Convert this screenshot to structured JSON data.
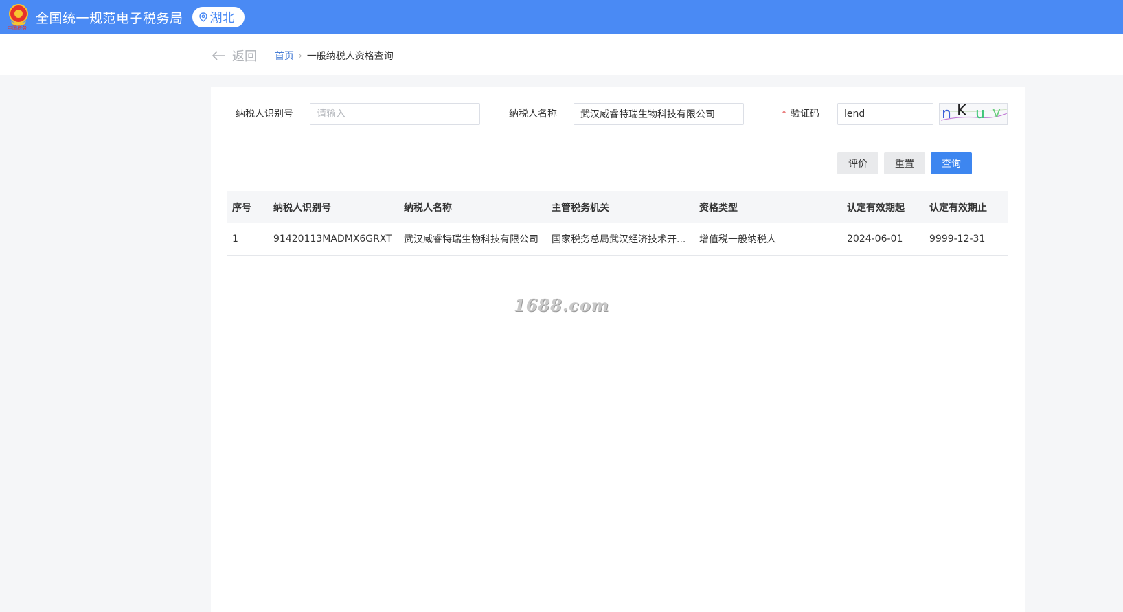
{
  "header": {
    "emblem": "tax-emblem-icon",
    "emblem_caption": "中国税务",
    "title": "全国统一规范电子税务局",
    "region": "湖北",
    "region_icon": "location-pin-icon"
  },
  "nav": {
    "back_label": "返回",
    "breadcrumb_home": "首页",
    "breadcrumb_separator": "›",
    "breadcrumb_current": "一般纳税人资格查询"
  },
  "form": {
    "taxpayer_id_label": "纳税人识别号",
    "taxpayer_id_value": "",
    "taxpayer_id_placeholder": "请输入",
    "taxpayer_name_label": "纳税人名称",
    "taxpayer_name_value": "武汉威睿特瑞生物科技有限公司",
    "captcha_required_mark": "*",
    "captcha_label": "验证码",
    "captcha_value": "lend",
    "captcha_chars": [
      "n",
      "K",
      "u",
      "v"
    ]
  },
  "buttons": {
    "rate": "评价",
    "reset": "重置",
    "query": "查询"
  },
  "table": {
    "columns": [
      "序号",
      "纳税人识别号",
      "纳税人名称",
      "主管税务机关",
      "资格类型",
      "认定有效期起",
      "认定有效期止"
    ],
    "rows": [
      [
        "1",
        "91420113MADMX6GRXT",
        "武汉威睿特瑞生物科技有限公司",
        "国家税务总局武汉经济技术开...",
        "增值税一般纳税人",
        "2024-06-01",
        "9999-12-31"
      ]
    ]
  },
  "watermark": "1688.com",
  "colors": {
    "header_bg": "#4a8af4",
    "primary_button": "#3d86f0",
    "link": "#4a7fd6",
    "required": "#e24c4c"
  }
}
